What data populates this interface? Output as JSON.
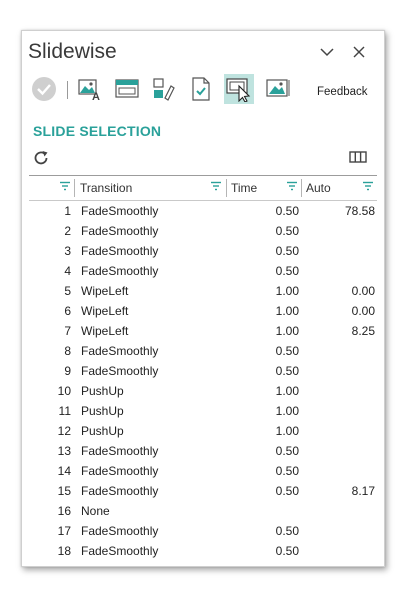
{
  "app": {
    "title": "Slidewise"
  },
  "toolbar": {
    "feedback_label": "Feedback"
  },
  "section": {
    "title": "SLIDE SELECTION"
  },
  "grid": {
    "headers": {
      "transition": "Transition",
      "time": "Time",
      "auto": "Auto"
    },
    "rows": [
      {
        "num": "1",
        "transition": "FadeSmoothly",
        "time": "0.50",
        "auto": "78.58"
      },
      {
        "num": "2",
        "transition": "FadeSmoothly",
        "time": "0.50",
        "auto": ""
      },
      {
        "num": "3",
        "transition": "FadeSmoothly",
        "time": "0.50",
        "auto": ""
      },
      {
        "num": "4",
        "transition": "FadeSmoothly",
        "time": "0.50",
        "auto": ""
      },
      {
        "num": "5",
        "transition": "WipeLeft",
        "time": "1.00",
        "auto": "0.00"
      },
      {
        "num": "6",
        "transition": "WipeLeft",
        "time": "1.00",
        "auto": "0.00"
      },
      {
        "num": "7",
        "transition": "WipeLeft",
        "time": "1.00",
        "auto": "8.25"
      },
      {
        "num": "8",
        "transition": "FadeSmoothly",
        "time": "0.50",
        "auto": ""
      },
      {
        "num": "9",
        "transition": "FadeSmoothly",
        "time": "0.50",
        "auto": ""
      },
      {
        "num": "10",
        "transition": "PushUp",
        "time": "1.00",
        "auto": ""
      },
      {
        "num": "11",
        "transition": "PushUp",
        "time": "1.00",
        "auto": ""
      },
      {
        "num": "12",
        "transition": "PushUp",
        "time": "1.00",
        "auto": ""
      },
      {
        "num": "13",
        "transition": "FadeSmoothly",
        "time": "0.50",
        "auto": ""
      },
      {
        "num": "14",
        "transition": "FadeSmoothly",
        "time": "0.50",
        "auto": ""
      },
      {
        "num": "15",
        "transition": "FadeSmoothly",
        "time": "0.50",
        "auto": "8.17"
      },
      {
        "num": "16",
        "transition": "None",
        "time": "",
        "auto": ""
      },
      {
        "num": "17",
        "transition": "FadeSmoothly",
        "time": "0.50",
        "auto": ""
      },
      {
        "num": "18",
        "transition": "FadeSmoothly",
        "time": "0.50",
        "auto": ""
      }
    ]
  },
  "colors": {
    "accent": "#2aa19a",
    "active_tool_bg": "#bfe3df",
    "text": "#222222"
  }
}
